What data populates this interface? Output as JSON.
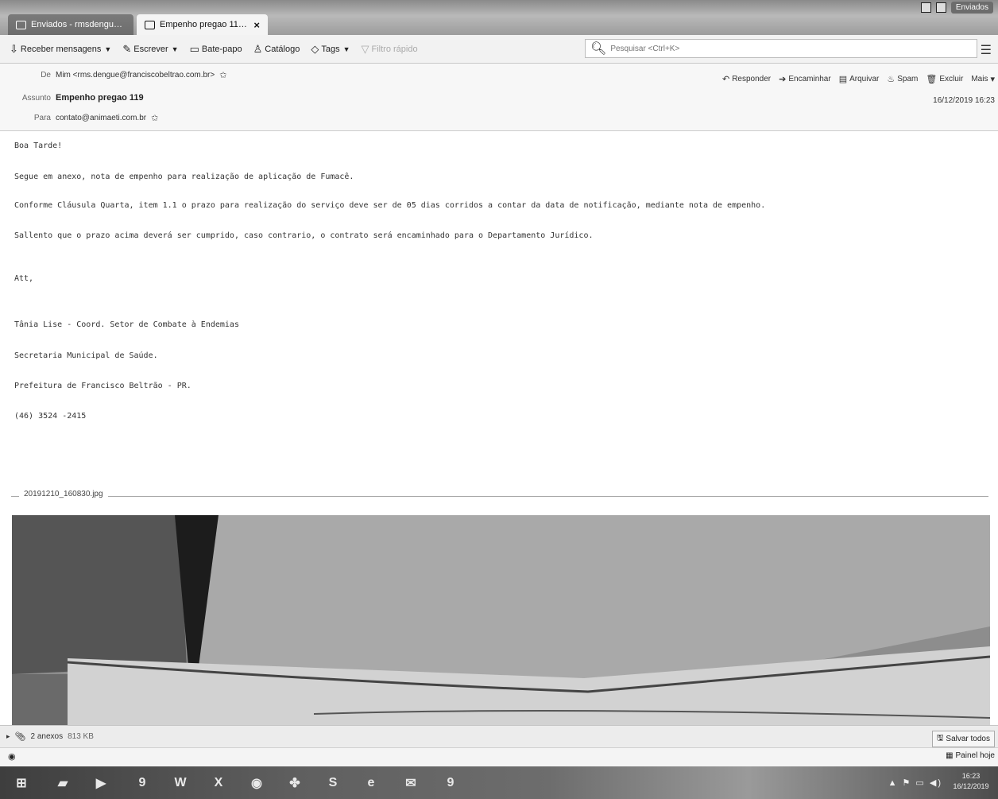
{
  "window": {
    "tabs": [
      {
        "label": "Enviados - rmsdengue@franc…",
        "active": false
      },
      {
        "label": "Empenho pregao 119 - Em…",
        "active": true
      }
    ],
    "window_label": "Enviados"
  },
  "toolbar": {
    "get_messages": "Receber mensagens",
    "write": "Escrever",
    "chat": "Bate-papo",
    "address_book": "Catálogo",
    "tags": "Tags",
    "quick_filter": "Filtro rápido",
    "search_placeholder": "Pesquisar <Ctrl+K>"
  },
  "header": {
    "from_label": "De",
    "from_value": "Mim <rms.dengue@franciscobeltrao.com.br>",
    "subject_label": "Assunto",
    "subject_value": "Empenho pregao 119",
    "to_label": "Para",
    "to_value": "contato@animaeti.com.br",
    "date": "16/12/2019 16:23",
    "actions": {
      "reply": "Responder",
      "forward": "Encaminhar",
      "archive": "Arquivar",
      "junk": "Spam",
      "delete": "Excluir",
      "more": "Mais"
    }
  },
  "body": {
    "greeting": "Boa Tarde!",
    "p1": "Segue em anexo, nota de empenho para realização de aplicação de Fumacê.",
    "p2": "Conforme Cláusula Quarta, item 1.1 o prazo para realização do serviço deve ser de 05 dias corridos a contar da data de notificação, mediante nota de empenho.",
    "p3": "Sallento que o prazo acima deverá ser cumprido, caso contrario, o contrato será encaminhado para o Departamento Jurídico.",
    "closing": "Att,",
    "sig1": "Tânia Lise - Coord. Setor de Combate à Endemias",
    "sig2": "Secretaria Municipal de Saúde.",
    "sig3": "Prefeitura de Francisco Beltrão - PR.",
    "sig4": "(46) 3524 -2415"
  },
  "attachment": {
    "filename": "20191210_160830.jpg",
    "bar_count": "2 anexos",
    "bar_size": "813 KB",
    "save_all": "Salvar todos"
  },
  "statusbar": {
    "today_pane": "Painel hoje"
  },
  "taskbar": {
    "clock_time": "16:23",
    "clock_date": "16/12/2019"
  }
}
